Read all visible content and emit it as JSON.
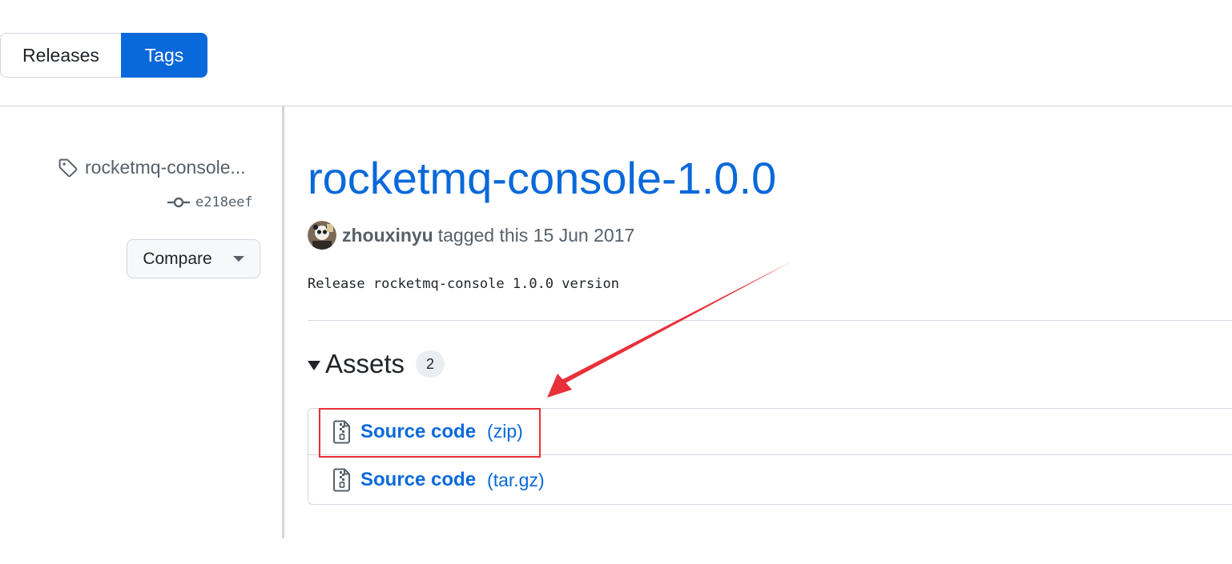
{
  "tabs": {
    "releases": "Releases",
    "tags": "Tags"
  },
  "sidebar": {
    "tag_name": "rocketmq-console...",
    "commit": "e218eef",
    "compare_label": "Compare"
  },
  "release": {
    "title": "rocketmq-console-1.0.0",
    "author": "zhouxinyu",
    "tagged_text": "tagged this 15 Jun 2017",
    "body": "Release rocketmq-console 1.0.0 version"
  },
  "assets": {
    "title": "Assets",
    "count": "2",
    "items": [
      {
        "label": "Source code",
        "ext": "(zip)"
      },
      {
        "label": "Source code",
        "ext": "(tar.gz)"
      }
    ]
  },
  "colors": {
    "link": "#0969da",
    "annotation": "#e8303a",
    "border": "#d0d7de"
  }
}
